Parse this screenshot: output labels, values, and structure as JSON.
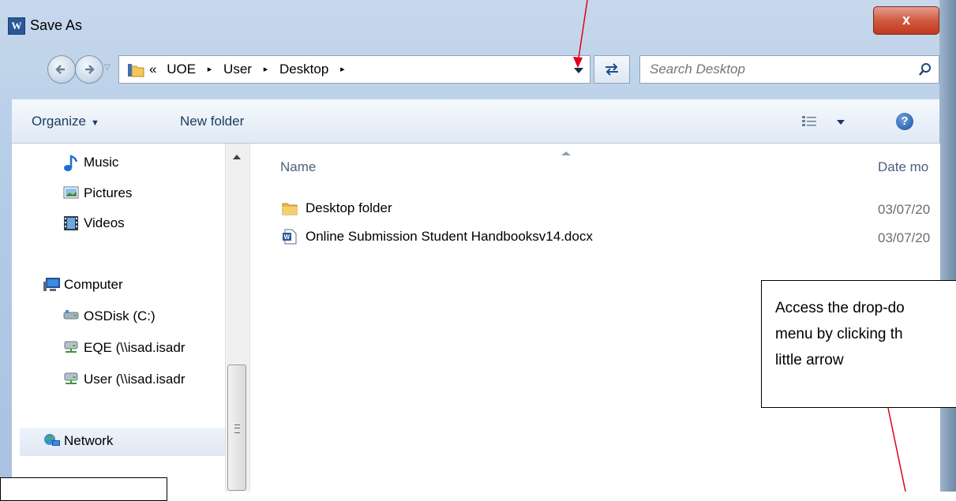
{
  "window": {
    "title": "Save As",
    "app_icon_letter": "W",
    "close_label": "x"
  },
  "address": {
    "overflow_marker": "«",
    "crumbs": [
      "UOE",
      "User",
      "Desktop"
    ],
    "separator": "▸"
  },
  "search": {
    "placeholder": "Search Desktop"
  },
  "toolbar": {
    "organize_label": "Organize",
    "organize_arrow": "▼",
    "new_folder_label": "New folder",
    "help_label": "?"
  },
  "nav": {
    "items": [
      {
        "label": "Music",
        "icon": "music-icon"
      },
      {
        "label": "Pictures",
        "icon": "pictures-icon"
      },
      {
        "label": "Videos",
        "icon": "videos-icon"
      },
      {
        "label": "Computer",
        "icon": "computer-icon"
      },
      {
        "label": "OSDisk (C:)",
        "icon": "disk-icon"
      },
      {
        "label": "EQE (\\\\isad.isadr",
        "icon": "network-drive-icon"
      },
      {
        "label": "User (\\\\isad.isadr",
        "icon": "network-drive-icon"
      },
      {
        "label": "Network",
        "icon": "network-icon"
      }
    ]
  },
  "files": {
    "col_name": "Name",
    "col_date": "Date mo",
    "rows": [
      {
        "name": "Desktop folder",
        "date": "03/07/20",
        "icon": "folder-icon"
      },
      {
        "name": "Online Submission Student Handbooksv14.docx",
        "date": "03/07/20",
        "icon": "word-document-icon"
      }
    ]
  },
  "callout": {
    "lines": [
      "Access the drop-do",
      "menu by clicking th",
      "little arrow"
    ]
  },
  "colors": {
    "annotation_arrow": "#e0001b",
    "close_button": "#c7432a",
    "chrome": "#b9cee7"
  }
}
